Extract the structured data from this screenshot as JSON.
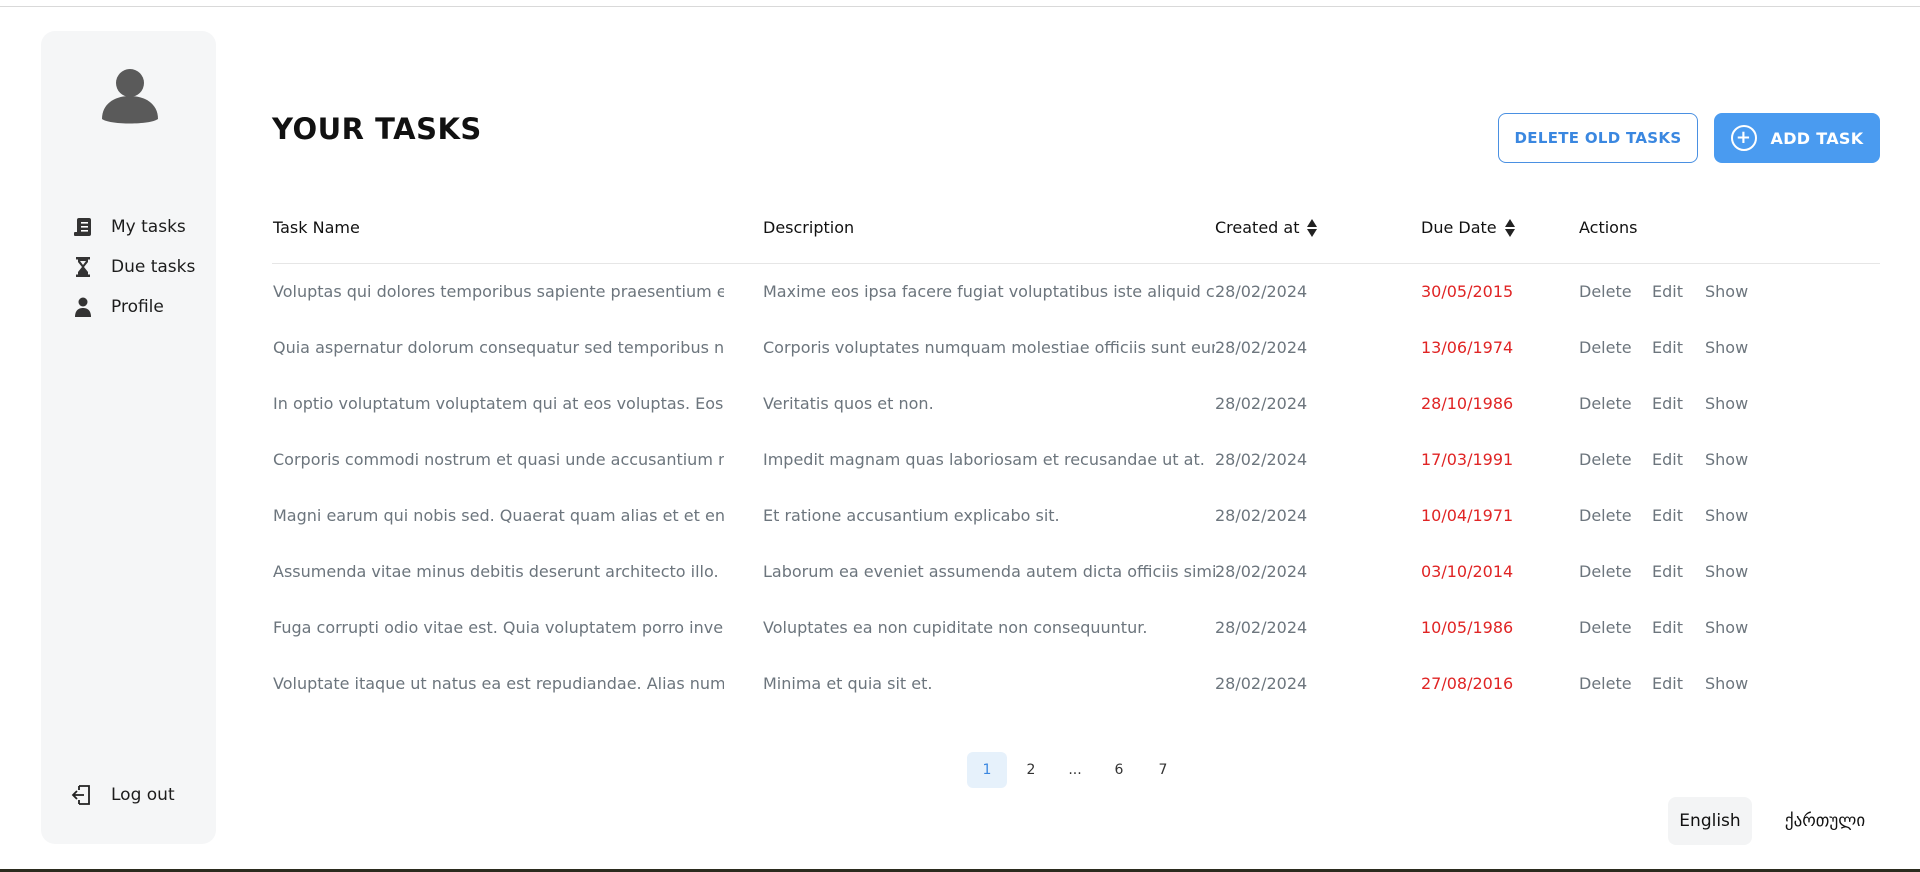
{
  "sidebar": {
    "items": [
      {
        "label": "My tasks",
        "icon": "task-list-icon"
      },
      {
        "label": "Due tasks",
        "icon": "hourglass-icon"
      },
      {
        "label": "Profile",
        "icon": "user-icon"
      }
    ],
    "logout_label": "Log out"
  },
  "header": {
    "title": "YOUR TASKS",
    "delete_old_label": "DELETE OLD TASKS",
    "add_task_label": "ADD TASK"
  },
  "table": {
    "columns": {
      "name": "Task Name",
      "description": "Description",
      "created": "Created at",
      "due": "Due Date",
      "actions": "Actions"
    },
    "action_labels": {
      "delete": "Delete",
      "edit": "Edit",
      "show": "Show"
    },
    "rows": [
      {
        "name": "Voluptas qui dolores temporibus sapiente praesentium eum au",
        "description": "Maxime eos ipsa facere fugiat voluptatibus iste aliquid cc",
        "created": "28/02/2024",
        "due": "30/05/2015"
      },
      {
        "name": "Quia aspernatur dolorum consequatur sed temporibus nihil. Pe",
        "description": "Corporis voluptates numquam molestiae officiis sunt eun",
        "created": "28/02/2024",
        "due": "13/06/1974"
      },
      {
        "name": "In optio voluptatum voluptatem qui at eos voluptas. Eos quam",
        "description": "Veritatis quos et non.",
        "created": "28/02/2024",
        "due": "28/10/1986"
      },
      {
        "name": "Corporis commodi nostrum et quasi unde accusantium molesti",
        "description": "Impedit magnam quas laboriosam et recusandae ut at.",
        "created": "28/02/2024",
        "due": "17/03/1991"
      },
      {
        "name": "Magni earum qui nobis sed. Quaerat quam alias et et enim non",
        "description": "Et ratione accusantium explicabo sit.",
        "created": "28/02/2024",
        "due": "10/04/1971"
      },
      {
        "name": "Assumenda vitae minus debitis deserunt architecto illo. Quia d",
        "description": "Laborum ea eveniet assumenda autem dicta officiis simili",
        "created": "28/02/2024",
        "due": "03/10/2014"
      },
      {
        "name": "Fuga corrupti odio vitae est. Quia voluptatem porro inventore",
        "description": "Voluptates ea non cupiditate non consequuntur.",
        "created": "28/02/2024",
        "due": "10/05/1986"
      },
      {
        "name": "Voluptate itaque ut natus ea est repudiandae. Alias numquam",
        "description": "Minima et quia sit et.",
        "created": "28/02/2024",
        "due": "27/08/2016"
      }
    ]
  },
  "pagination": {
    "pages": [
      "1",
      "2",
      "...",
      "6",
      "7"
    ],
    "current": "1"
  },
  "language": {
    "english": "English",
    "georgian": "ქართული"
  },
  "colors": {
    "accent": "#4a9bf0",
    "due_date": "#e02424",
    "muted_text": "#6c757d",
    "sidebar_bg": "#f5f6f7"
  }
}
